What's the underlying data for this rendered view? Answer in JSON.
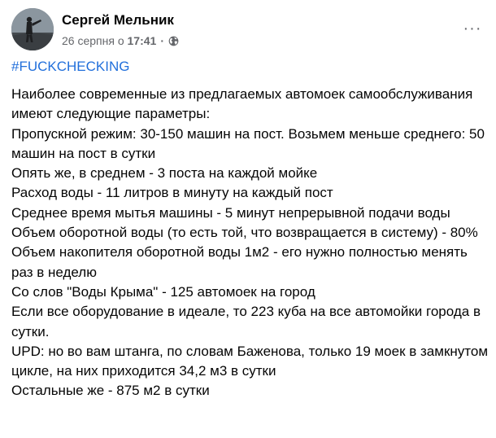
{
  "post": {
    "author": "Сергей Мельник",
    "date": "26 серпня о",
    "time": "17:41",
    "separator": "·",
    "privacy_icon": "globe-icon",
    "more_icon": "more-options-icon",
    "more_glyph": "···",
    "hashtag": "#FUCKCHECKING",
    "lines": [
      "Наиболее современные из предлагаемых автомоек самообслуживания имеют следующие параметры:",
      "Пропускной режим: 30-150 машин на пост. Возьмем меньше среднего: 50 машин на пост в сутки",
      "Опять же, в среднем - 3 поста на каждой мойке",
      "Расход воды - 11 литров в минуту на каждый пост",
      "Среднее время мытья машины - 5 минут непрерывной подачи воды",
      "Объем оборотной воды (то есть той, что возвращается в систему) - 80%",
      "Объем накопителя оборотной воды 1м2 - его нужно полностью менять раз в неделю",
      "Со слов \"Воды Крыма\" - 125 автомоек на город",
      "Если все оборудование в идеале, то 223 куба на все автомойки города в сутки.",
      "UPD: но во вам штанга, по словам Баженова, только 19 моек в замкнутом цикле, на них приходится 34,2 м3 в сутки",
      "Остальные же - 875 м2 в сутки"
    ]
  },
  "colors": {
    "text": "#050505",
    "secondary": "#65676b",
    "link": "#216fdb",
    "background": "#ffffff"
  }
}
